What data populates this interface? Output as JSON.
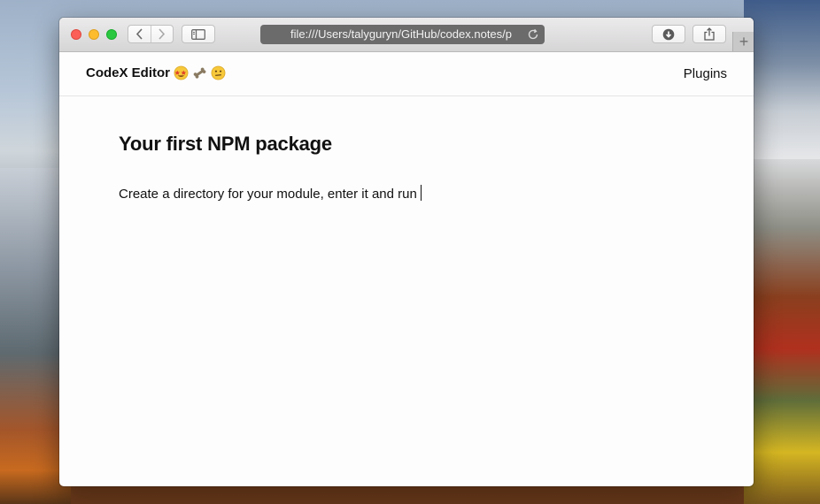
{
  "browser": {
    "url": "file:///Users/talyguryn/GitHub/codex.notes/p",
    "icons": {
      "back": "chevron-left-icon",
      "forward": "chevron-right-icon",
      "sidebar": "sidebar-icon",
      "reload": "reload-icon",
      "download": "download-icon",
      "share": "share-icon",
      "new_tab": "plus-icon"
    },
    "new_tab_label": "+"
  },
  "header": {
    "brand": "CodeX Editor",
    "brand_emojis": [
      "star-struck-emoji",
      "bone-emoji",
      "grimace-emoji"
    ],
    "plugins_label": "Plugins"
  },
  "editor": {
    "heading": "Your first NPM package",
    "paragraph": "Create a directory for your module, enter it and run"
  }
}
